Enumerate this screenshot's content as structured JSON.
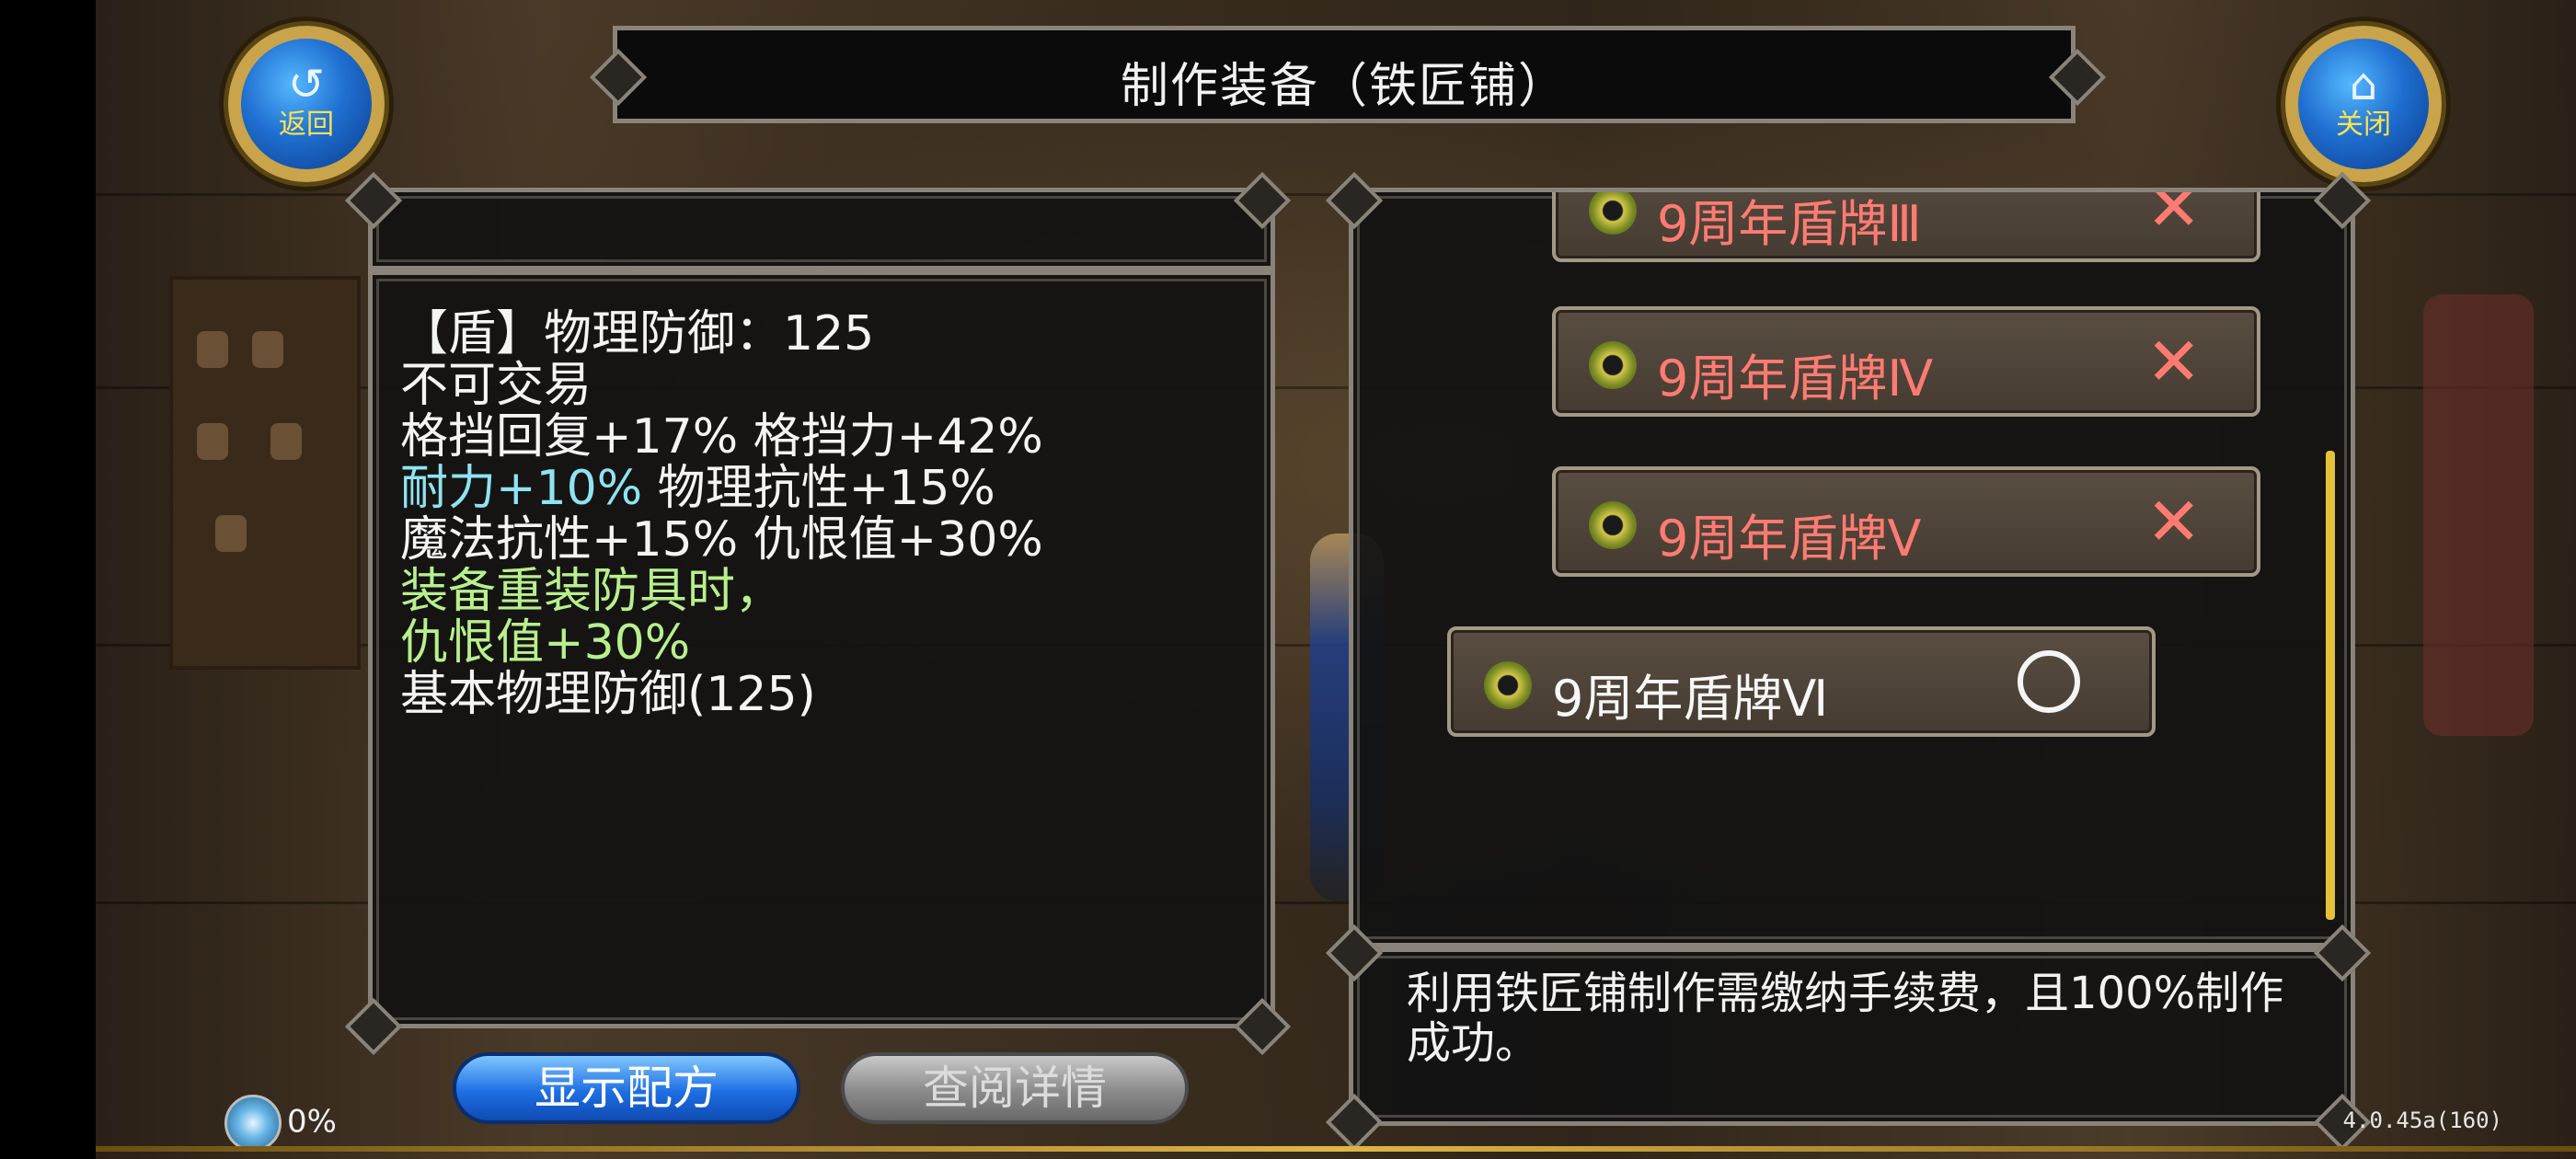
{
  "header": {
    "title": "制作装备（铁匠铺）"
  },
  "nav": {
    "back": {
      "label": "返回",
      "icon": "back-arrow-icon"
    },
    "close": {
      "label": "关闭",
      "icon": "home-icon"
    }
  },
  "item": {
    "lines": [
      "【盾】物理防御：125",
      "不可交易",
      "格挡回复+17% 格挡力+42%",
      "耐力+10%",
      " 物理抗性+15%",
      "魔法抗性+15% 仇恨值+30%",
      "装备重装防具时，",
      "仇恨值+30%",
      "基本物理防御(125)"
    ]
  },
  "recipes": {
    "items": [
      {
        "name": "9周年盾牌Ⅲ",
        "status": "unavailable",
        "mark": "✕"
      },
      {
        "name": "9周年盾牌Ⅳ",
        "status": "unavailable",
        "mark": "✕"
      },
      {
        "name": "9周年盾牌Ⅴ",
        "status": "unavailable",
        "mark": "✕"
      },
      {
        "name": "9周年盾牌Ⅵ",
        "status": "available",
        "mark": "○"
      }
    ]
  },
  "description": "利用铁匠铺制作需缴纳手续费，且100%制作成功。",
  "buttons": {
    "show_recipe": "显示配方",
    "view_details": "查阅详情"
  },
  "status": {
    "progress": "0%",
    "version": "4.0.45a(160)"
  },
  "colors": {
    "unavailable": "#ff7b72",
    "cyan_stat": "#8fe3f2",
    "green_stat": "#b7f08c",
    "accent_gold": "#e0b646"
  }
}
